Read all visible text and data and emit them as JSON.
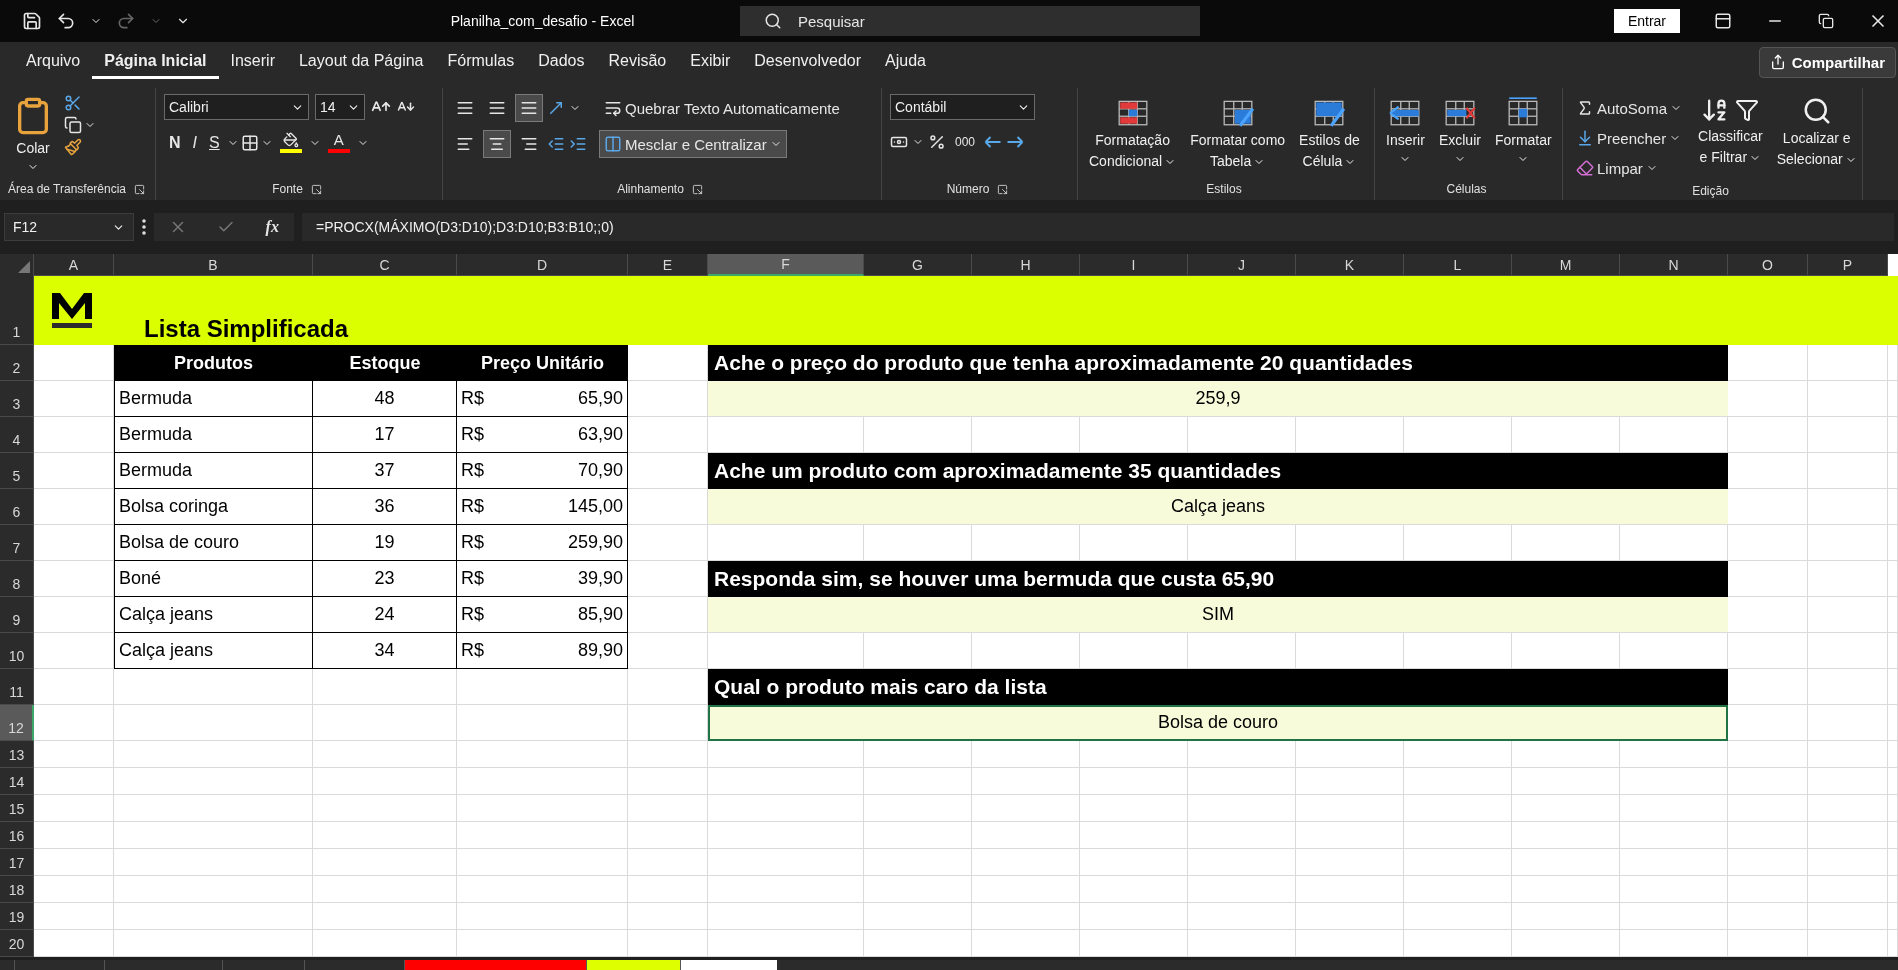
{
  "title_bar": {
    "title": "Planilha_com_desafio  -  Excel",
    "search_placeholder": "Pesquisar",
    "sign_in": "Entrar"
  },
  "menu_tabs": [
    {
      "label": "Arquivo",
      "selected": false
    },
    {
      "label": "Página Inicial",
      "selected": true
    },
    {
      "label": "Inserir",
      "selected": false
    },
    {
      "label": "Layout da Página",
      "selected": false
    },
    {
      "label": "Fórmulas",
      "selected": false
    },
    {
      "label": "Dados",
      "selected": false
    },
    {
      "label": "Revisão",
      "selected": false
    },
    {
      "label": "Exibir",
      "selected": false
    },
    {
      "label": "Desenvolvedor",
      "selected": false
    },
    {
      "label": "Ajuda",
      "selected": false
    }
  ],
  "share_button": "Compartilhar",
  "ribbon": {
    "clipboard": {
      "label": "Área de Transferência",
      "launcher": true,
      "paste": "Colar"
    },
    "font": {
      "label": "Fonte",
      "launcher": true,
      "font_name": "Calibri",
      "font_size": "14",
      "bold": "N",
      "italic": "I",
      "underline": "S",
      "font_color": "A"
    },
    "alignment": {
      "label": "Alinhamento",
      "launcher": true,
      "wrap_text": "Quebrar Texto Automaticamente",
      "merge": {
        "label": "Mesclar e Centralizar",
        "selected": true
      },
      "vertical": [
        {
          "selected": false
        },
        {
          "selected": false
        },
        {
          "selected": true
        }
      ],
      "horizontal": [
        {
          "selected": false
        },
        {
          "selected": true
        },
        {
          "selected": false
        }
      ]
    },
    "number": {
      "label": "Número",
      "launcher": true,
      "format": "Contábil",
      "thousands": "000"
    },
    "styles": {
      "label": "Estilos",
      "buttons": [
        {
          "kind": "conditional",
          "lines": [
            "Formatação",
            "Condicional"
          ]
        },
        {
          "kind": "table",
          "lines": [
            "Formatar como",
            "Tabela"
          ]
        },
        {
          "kind": "cell",
          "lines": [
            "Estilos de",
            "Célula"
          ]
        }
      ]
    },
    "cells": {
      "label": "Células",
      "buttons": [
        {
          "kind": "insert",
          "label": "Inserir"
        },
        {
          "kind": "delete",
          "label": "Excluir"
        },
        {
          "kind": "format",
          "label": "Formatar"
        }
      ]
    },
    "editing": {
      "label": "Edição",
      "autosum": "AutoSoma",
      "fill": "Preencher",
      "clear": "Limpar",
      "sort": [
        "Classificar",
        "e Filtrar"
      ],
      "find": [
        "Localizar e",
        "Selecionar"
      ]
    }
  },
  "formula_bar": {
    "name_box": "F12",
    "fx": "fx",
    "formula": "=PROCX(MÁXIMO(D3:D10);D3:D10;B3:B10;;0)"
  },
  "columns": [
    {
      "label": "A",
      "selected": false
    },
    {
      "label": "B",
      "selected": false
    },
    {
      "label": "C",
      "selected": false
    },
    {
      "label": "D",
      "selected": false
    },
    {
      "label": "E",
      "selected": false
    },
    {
      "label": "F",
      "selected": true
    },
    {
      "label": "G",
      "selected": false
    },
    {
      "label": "H",
      "selected": false
    },
    {
      "label": "I",
      "selected": false
    },
    {
      "label": "J",
      "selected": false
    },
    {
      "label": "K",
      "selected": false
    },
    {
      "label": "L",
      "selected": false
    },
    {
      "label": "M",
      "selected": false
    },
    {
      "label": "N",
      "selected": false
    },
    {
      "label": "O",
      "selected": false
    },
    {
      "label": "P",
      "selected": false
    }
  ],
  "rows": [
    {
      "label": "1",
      "selected": false
    },
    {
      "label": "2",
      "selected": false
    },
    {
      "label": "3",
      "selected": false
    },
    {
      "label": "4",
      "selected": false
    },
    {
      "label": "5",
      "selected": false
    },
    {
      "label": "6",
      "selected": false
    },
    {
      "label": "7",
      "selected": false
    },
    {
      "label": "8",
      "selected": false
    },
    {
      "label": "9",
      "selected": false
    },
    {
      "label": "10",
      "selected": false
    },
    {
      "label": "11",
      "selected": false
    },
    {
      "label": "12",
      "selected": true
    },
    {
      "label": "13",
      "selected": false
    },
    {
      "label": "14",
      "selected": false
    },
    {
      "label": "15",
      "selected": false
    },
    {
      "label": "16",
      "selected": false
    },
    {
      "label": "17",
      "selected": false
    },
    {
      "label": "18",
      "selected": false
    },
    {
      "label": "19",
      "selected": false
    },
    {
      "label": "20",
      "selected": false
    }
  ],
  "sheet": {
    "title": "Lista Simplificada",
    "table": {
      "columns": [
        "Produtos",
        "Estoque",
        "Preço Unitário"
      ],
      "rows": [
        {
          "product": "Bermuda",
          "stock": "48",
          "currency": "R$",
          "price": "65,90"
        },
        {
          "product": "Bermuda",
          "stock": "17",
          "currency": "R$",
          "price": "63,90"
        },
        {
          "product": "Bermuda",
          "stock": "37",
          "currency": "R$",
          "price": "70,90"
        },
        {
          "product": "Bolsa coringa",
          "stock": "36",
          "currency": "R$",
          "price": "145,00"
        },
        {
          "product": "Bolsa de couro",
          "stock": "19",
          "currency": "R$",
          "price": "259,90"
        },
        {
          "product": "Boné",
          "stock": "23",
          "currency": "R$",
          "price": "39,90"
        },
        {
          "product": "Calça jeans",
          "stock": "24",
          "currency": "R$",
          "price": "85,90"
        },
        {
          "product": "Calça jeans",
          "stock": "34",
          "currency": "R$",
          "price": "89,90"
        }
      ]
    },
    "questions": [
      {
        "question": "Ache o preço do produto que tenha aproximadamente 20 quantidades",
        "answer": "259,9",
        "selected": false
      },
      {
        "question": "Ache um produto com aproximadamente 35 quantidades",
        "answer": "Calça jeans",
        "selected": false
      },
      {
        "question": "Responda sim, se houver uma bermuda que custa 65,90",
        "answer": "SIM",
        "selected": false
      },
      {
        "question": "Qual o produto mais caro da lista",
        "answer": "Bolsa de couro",
        "selected": true
      }
    ]
  },
  "sheet_tabs": [
    {
      "selected": false
    },
    {
      "selected": false
    },
    {
      "selected": false
    },
    {
      "selected": false
    },
    {
      "selected": false,
      "color": "#ff0000"
    },
    {
      "selected": false,
      "color": "#ddff00"
    },
    {
      "selected": true
    }
  ]
}
